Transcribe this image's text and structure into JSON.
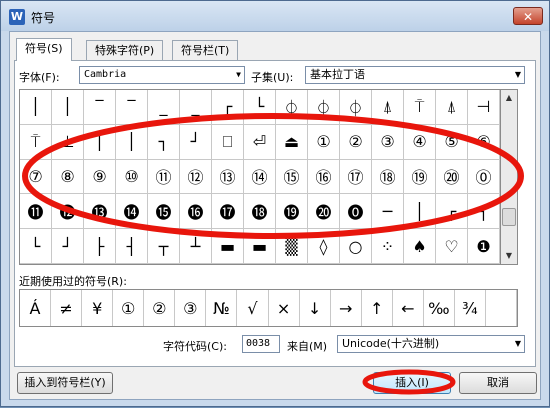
{
  "window": {
    "title": "符号",
    "app_icon_letter": "W",
    "close_glyph": "✕"
  },
  "tabs": [
    {
      "label": "符号(S)",
      "active": true
    },
    {
      "label": "特殊字符(P)",
      "active": false
    },
    {
      "label": "符号栏(T)",
      "active": false
    }
  ],
  "font": {
    "label": "字体(F):",
    "value": "Cambria"
  },
  "subset": {
    "label": "子集(U):",
    "value": "基本拉丁语"
  },
  "symbol_grid": [
    [
      "│",
      "│",
      "‾",
      "‾",
      "_",
      "_",
      "┌",
      "└",
      "⏀",
      "⏀",
      "⏀",
      "⍋",
      "⍑",
      "⍋",
      "⊣"
    ],
    [
      "⍑",
      "⊥",
      "│",
      "│",
      "┐",
      "┘",
      "⎕",
      "⏎",
      "⏏",
      "①",
      "②",
      "③",
      "④",
      "⑤",
      "⑥"
    ],
    [
      "⑦",
      "⑧",
      "⑨",
      "⑩",
      "⑪",
      "⑫",
      "⑬",
      "⑭",
      "⑮",
      "⑯",
      "⑰",
      "⑱",
      "⑲",
      "⑳",
      "⓪"
    ],
    [
      "⓫",
      "⓬",
      "⓭",
      "⓮",
      "⓯",
      "⓰",
      "⓱",
      "⓲",
      "⓳",
      "⓴",
      "⓿",
      "─",
      "│",
      "┌",
      "┐"
    ],
    [
      "└",
      "┘",
      "├",
      "┤",
      "┬",
      "┴",
      "▬",
      "▬",
      "▒",
      "◊",
      "○",
      "⁘",
      "♠",
      "♡",
      "❶"
    ]
  ],
  "recent": {
    "label": "近期使用过的符号(R):",
    "symbols": [
      "Á",
      "≠",
      "¥",
      "①",
      "②",
      "③",
      "№",
      "√",
      "×",
      "↓",
      "→",
      "↑",
      "←",
      "‰",
      "¾",
      ""
    ]
  },
  "code": {
    "label": "字符代码(C):",
    "value": "0038",
    "from_label": "来自(M)",
    "from_value": "Unicode(十六进制)"
  },
  "buttons": {
    "insert_to_bar": "插入到符号栏(Y)",
    "insert": "插入(I)",
    "cancel": "取消"
  },
  "colors": {
    "annotation": "#e8160c"
  },
  "scroll": {
    "up": "▲",
    "down": "▼"
  },
  "combo_arrow": "▼"
}
